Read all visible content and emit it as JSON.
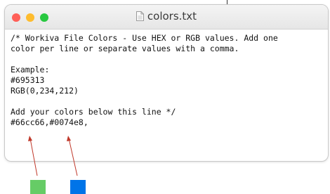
{
  "window": {
    "title": "colors.txt",
    "controls": {
      "close_color": "#ff5f57",
      "minimize_color": "#febc2e",
      "zoom_color": "#28c840"
    },
    "icon": "text-document-icon"
  },
  "file": {
    "lines": [
      "/* Workiva File Colors - Use HEX or RGB values. Add one",
      "color per line or separate values with a comma.",
      "",
      "Example:",
      "#695313",
      "RGB(0,234,212)",
      "",
      "Add your colors below this line */",
      "#66cc66,#0074e8,"
    ]
  },
  "annotations": {
    "arrow_color": "#c0392b",
    "swatches": [
      {
        "name": "green",
        "color": "#66cc66"
      },
      {
        "name": "blue",
        "color": "#0074e8"
      }
    ]
  }
}
